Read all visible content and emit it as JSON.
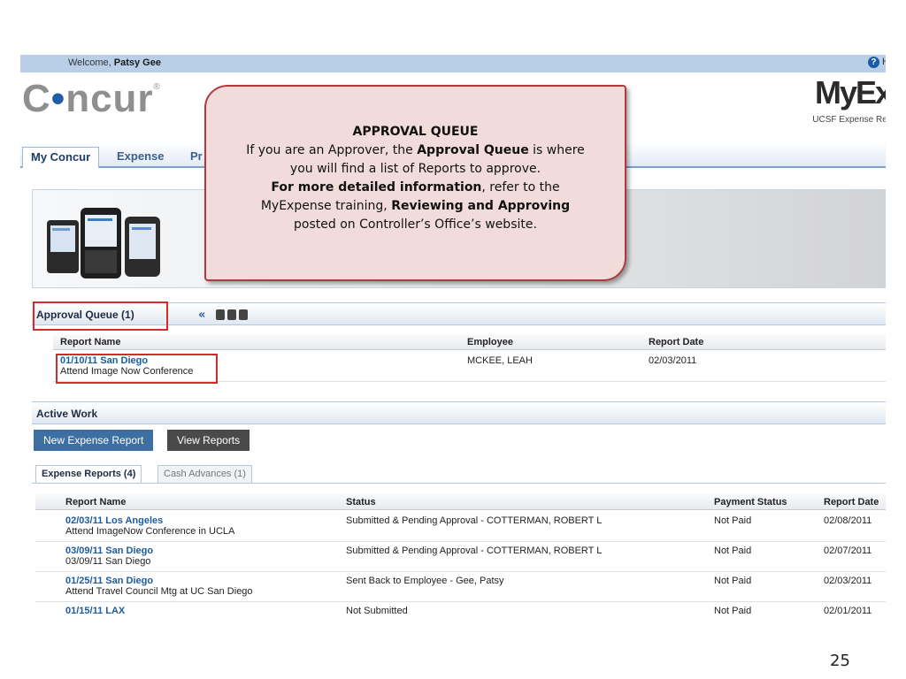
{
  "header": {
    "welcome_prefix": "Welcome,",
    "user_name": "Patsy Gee",
    "help_label": "H",
    "logo_text": "Concur",
    "product_title": "MyEx",
    "subtitle": "UCSF Expense Rei"
  },
  "nav": {
    "tabs": [
      "My Concur",
      "Expense",
      "Pr"
    ]
  },
  "callout": {
    "title": "APPROVAL QUEUE",
    "line1_a": "If you are an Approver, the ",
    "line1_b": "Approval Queue",
    "line1_c": " is where",
    "line2": "you will find a list of Reports to approve.",
    "line3_a": "For more detailed information",
    "line3_b": ", refer to the",
    "line4_a": "MyExpense training, ",
    "line4_b": "Reviewing and Approving",
    "line5": "posted on Controller’s Office’s website."
  },
  "approval_queue": {
    "title": "Approval Queue (1)",
    "columns": [
      "Report Name",
      "Employee",
      "Report Date"
    ],
    "rows": [
      {
        "name": "01/10/11 San Diego",
        "desc": "Attend Image Now Conference",
        "employee": "MCKEE, LEAH",
        "date": "02/03/2011"
      }
    ]
  },
  "active_work": {
    "title": "Active Work",
    "buttons": {
      "new_report": "New Expense Report",
      "view_reports": "View Reports"
    },
    "tabs": [
      "Expense Reports (4)",
      "Cash Advances (1)"
    ],
    "columns": [
      "Report Name",
      "Status",
      "Payment Status",
      "Report Date"
    ],
    "rows": [
      {
        "name": "02/03/11 Los Angeles",
        "desc": "Attend ImageNow Conference in UCLA",
        "status": "Submitted & Pending Approval - COTTERMAN, ROBERT L",
        "payment": "Not Paid",
        "date": "02/08/2011"
      },
      {
        "name": "03/09/11 San Diego",
        "desc": "03/09/11 San Diego",
        "status": "Submitted & Pending Approval - COTTERMAN, ROBERT L",
        "payment": "Not Paid",
        "date": "02/07/2011"
      },
      {
        "name": "01/25/11 San Diego",
        "desc": "Attend Travel Council Mtg at UC San Diego",
        "status": "Sent Back to Employee - Gee, Patsy",
        "payment": "Not Paid",
        "date": "02/03/2011"
      },
      {
        "name": "01/15/11 LAX",
        "desc": "",
        "status": "Not Submitted",
        "payment": "Not Paid",
        "date": "02/01/2011"
      }
    ]
  },
  "slide": {
    "page_number": "25"
  },
  "colors": {
    "accent": "#1c5b9e",
    "highlight_border": "#d42a2a",
    "callout_fill": "#f2dbdb",
    "topbar": "#b9cfe8"
  }
}
